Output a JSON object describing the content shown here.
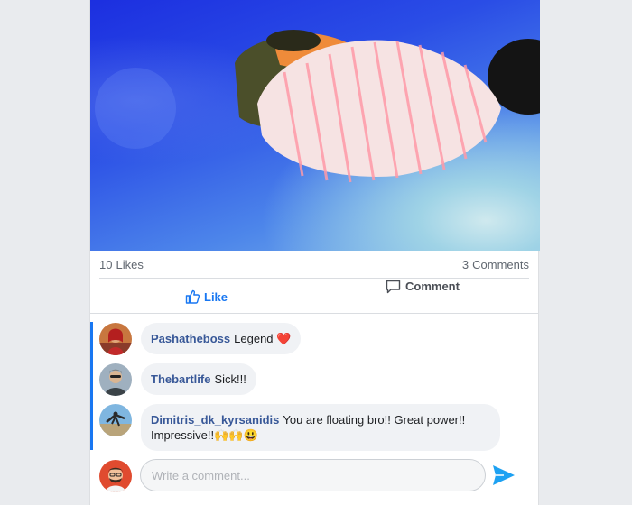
{
  "post": {
    "photo_alt": "person floating in blue sky",
    "stats": {
      "likes_count": "10",
      "likes_label": "Likes",
      "comments_count": "3",
      "comments_label": "Comments"
    },
    "actions": {
      "like_label": "Like",
      "comment_label": "Comment"
    }
  },
  "comments": [
    {
      "author": "Pashatheboss",
      "text": "Legend ❤️"
    },
    {
      "author": "Thebartlife",
      "text": "Sick!!!"
    },
    {
      "author": "Dimitris_dk_kyrsanidis",
      "text": "You are floating bro!! Great power!! Impressive!!🙌🙌😃"
    }
  ],
  "composer": {
    "placeholder": "Write a comment..."
  },
  "colors": {
    "accent": "#1877f2",
    "author": "#385898",
    "page_bg": "#e9ebee"
  }
}
